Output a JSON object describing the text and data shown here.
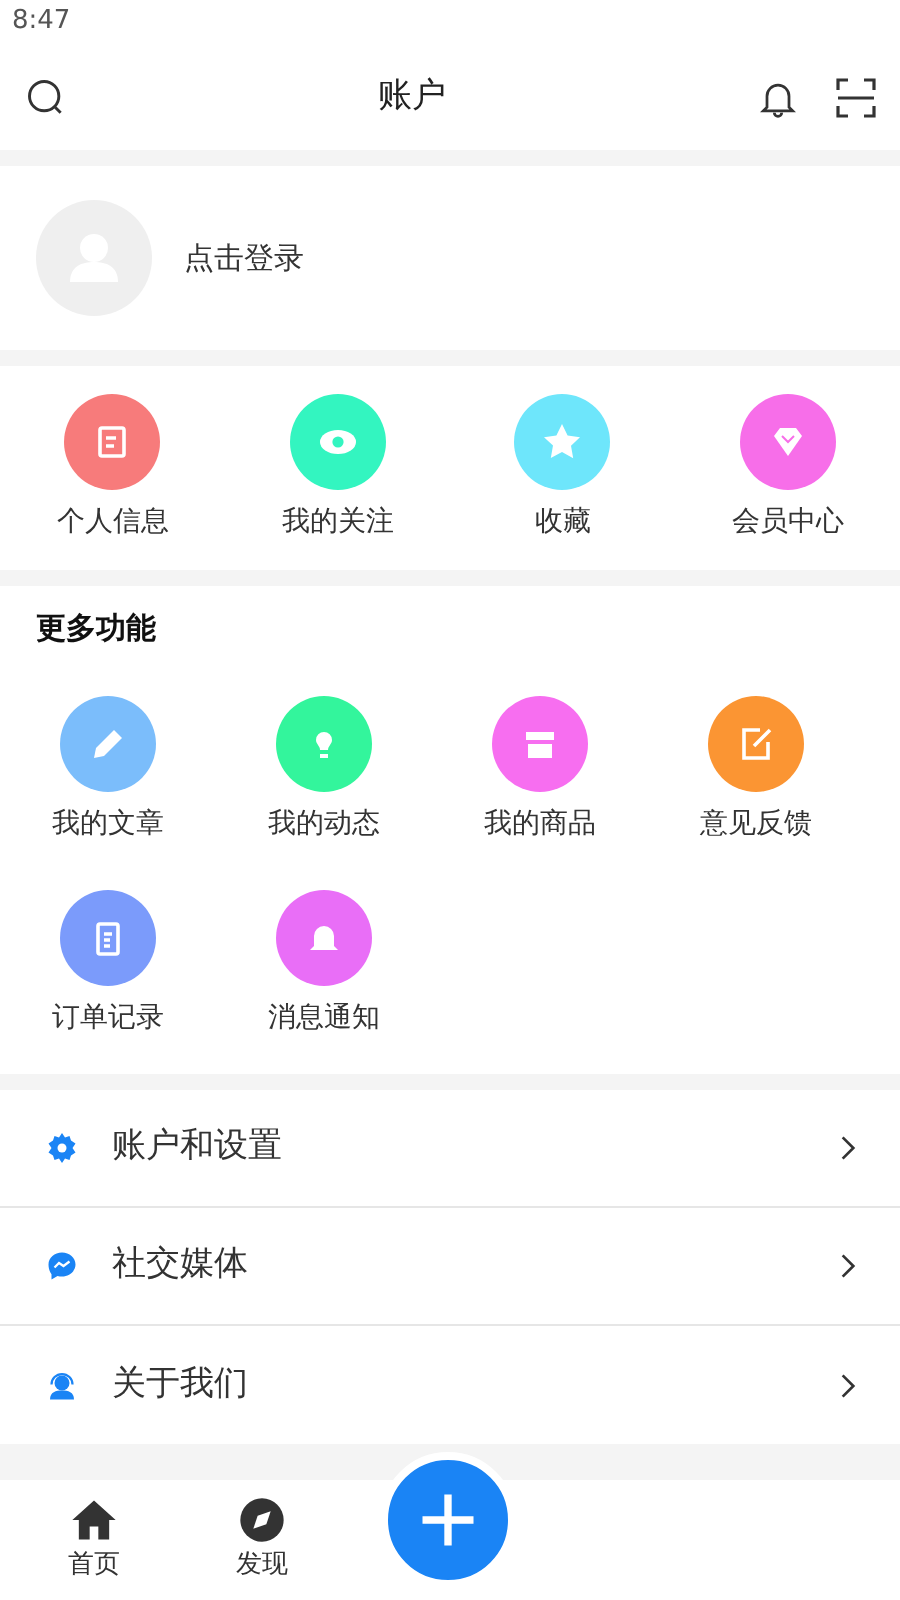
{
  "status_bar": {
    "time": "8:47"
  },
  "header": {
    "title": "账户"
  },
  "login": {
    "label": "点击登录"
  },
  "quick_actions": [
    {
      "label": "个人信息",
      "color": "#f77b7b"
    },
    {
      "label": "我的关注",
      "color": "#33f5c0"
    },
    {
      "label": "收藏",
      "color": "#6ee6fb"
    },
    {
      "label": "会员中心",
      "color": "#f76ee9"
    }
  ],
  "more_functions": {
    "title": "更多功能",
    "items": [
      {
        "label": "我的文章",
        "color": "#7bbdfb"
      },
      {
        "label": "我的动态",
        "color": "#33f59c"
      },
      {
        "label": "我的商品",
        "color": "#f76ef0"
      },
      {
        "label": "意见反馈",
        "color": "#fb9533"
      },
      {
        "label": "订单记录",
        "color": "#7b9bfb"
      },
      {
        "label": "消息通知",
        "color": "#e96ef7"
      }
    ]
  },
  "menu": [
    {
      "label": "账户和设置"
    },
    {
      "label": "社交媒体"
    },
    {
      "label": "关于我们"
    }
  ],
  "tab_bar": {
    "tabs": [
      {
        "label": "首页",
        "selected": false
      },
      {
        "label": "发现",
        "selected": false
      }
    ]
  }
}
